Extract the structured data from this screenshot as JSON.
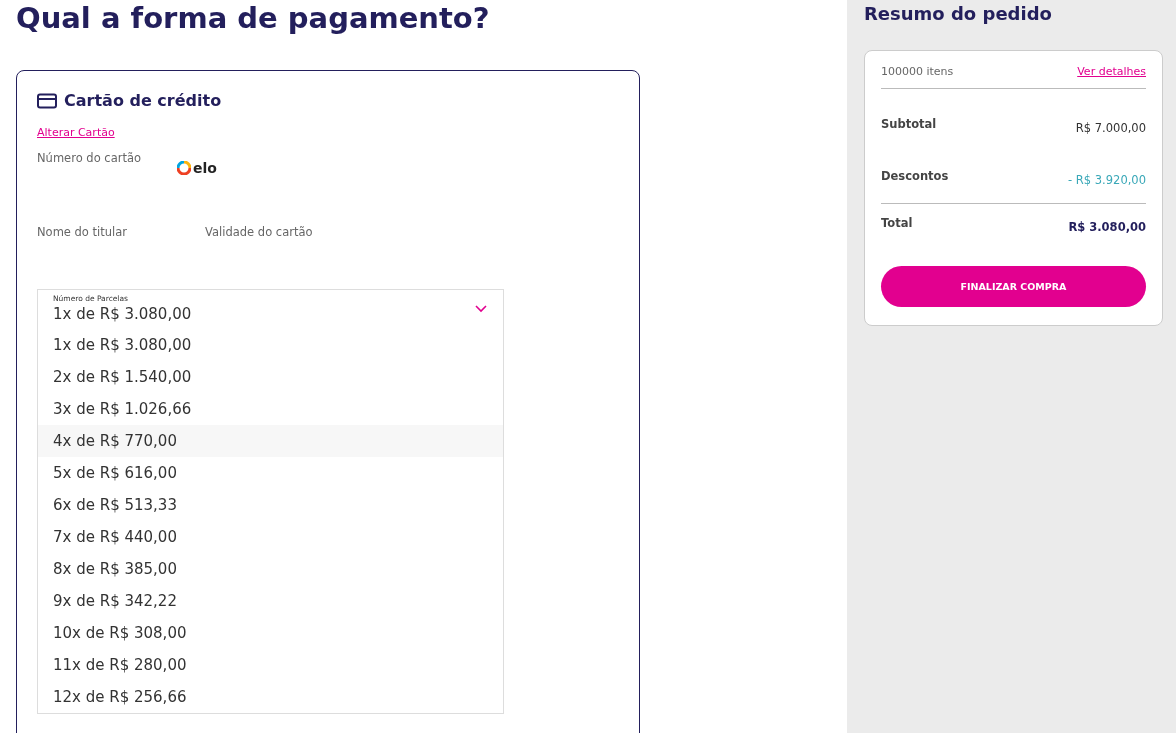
{
  "title": "Qual a forma de pagamento?",
  "payment": {
    "method": "Cartão de crédito",
    "change_link": "Alterar Cartão",
    "card_number_label": "Número do cartão",
    "brand": "elo",
    "holder_label": "Nome do titular",
    "expiry_label": "Validade do cartão",
    "installments": {
      "label": "Número de Parcelas",
      "value": "1x de R$ 3.080,00",
      "expanded": true,
      "options": [
        {
          "label": "1x de R$ 3.080,00",
          "highlighted": false
        },
        {
          "label": "2x de R$ 1.540,00",
          "highlighted": false
        },
        {
          "label": "3x de R$ 1.026,66",
          "highlighted": false
        },
        {
          "label": "4x de R$ 770,00",
          "highlighted": true
        },
        {
          "label": "5x de R$ 616,00",
          "highlighted": false
        },
        {
          "label": "6x de R$ 513,33",
          "highlighted": false
        },
        {
          "label": "7x de R$ 440,00",
          "highlighted": false
        },
        {
          "label": "8x de R$ 385,00",
          "highlighted": false
        },
        {
          "label": "9x de R$ 342,22",
          "highlighted": false
        },
        {
          "label": "10x de R$ 308,00",
          "highlighted": false
        },
        {
          "label": "11x de R$ 280,00",
          "highlighted": false
        },
        {
          "label": "12x de R$ 256,66",
          "highlighted": false
        }
      ]
    }
  },
  "summary": {
    "title": "Resumo do pedido",
    "items_count": "100000 itens",
    "details_link": "Ver detalhes",
    "rows": [
      {
        "kind": "subtotal",
        "label": "Subtotal",
        "value": "R$ 7.000,00"
      },
      {
        "kind": "discount",
        "label": "Descontos",
        "value": "- R$ 3.920,00"
      },
      {
        "kind": "total",
        "label": "Total",
        "value": "R$ 3.080,00"
      }
    ],
    "button": "FINALIZAR COMPRA"
  }
}
